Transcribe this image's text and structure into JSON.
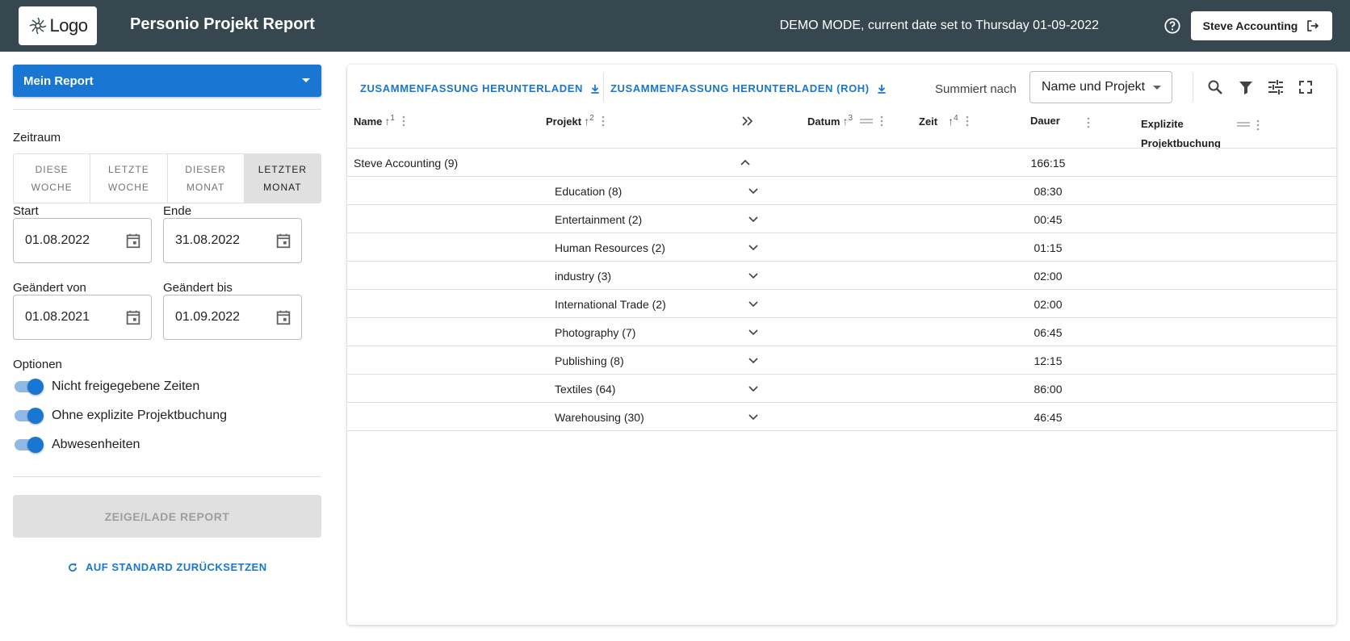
{
  "header": {
    "logo_text": "Logo",
    "title": "Personio Projekt Report",
    "demo_text": "DEMO MODE, current date set to Thursday 01-09-2022",
    "user_button": "Steve Accounting",
    "bg_color": "#37474f"
  },
  "sidebar": {
    "report_select": "Mein Report",
    "zeitraum_label": "Zeitraum",
    "zeitraum_options": [
      {
        "line1": "DIESE",
        "line2": "WOCHE"
      },
      {
        "line1": "LETZTE",
        "line2": "WOCHE"
      },
      {
        "line1": "DIESER",
        "line2": "MONAT"
      },
      {
        "line1": "LETZTER",
        "line2": "MONAT"
      }
    ],
    "zeitraum_selected": "LETZTER MONAT",
    "start_label": "Start",
    "start_value": "01.08.2022",
    "ende_label": "Ende",
    "ende_value": "31.08.2022",
    "geaendert_von_label": "Geändert von",
    "geaendert_von_value": "01.08.2021",
    "geaendert_bis_label": "Geändert bis",
    "geaendert_bis_value": "01.09.2022",
    "optionen_label": "Optionen",
    "options": [
      {
        "label": "Nicht freigegebene Zeiten",
        "on": true
      },
      {
        "label": "Ohne explizite Projektbuchung",
        "on": true
      },
      {
        "label": "Abwesenheiten",
        "on": true
      }
    ],
    "zeige_button": "ZEIGE/LADE REPORT",
    "reset_link": "AUF STANDARD ZURÜCKSETZEN",
    "accent_color": "#1976d2"
  },
  "toolbar": {
    "download_summary": "ZUSAMMENFASSUNG HERUNTERLADEN",
    "download_summary_raw": "ZUSAMMENFASSUNG HERUNTERLADEN (ROH)",
    "summiert_label": "Summiert nach",
    "summiert_value": "Name und Projekt",
    "icons": [
      "search-icon",
      "filter-icon",
      "tune-icon",
      "fullscreen-icon"
    ]
  },
  "table": {
    "columns": {
      "name": {
        "label": "Name",
        "sort": "1"
      },
      "projekt": {
        "label": "Projekt",
        "sort": "2"
      },
      "datum": {
        "label": "Datum",
        "sort": "3"
      },
      "zeit": {
        "label": "Zeit",
        "sort": "4"
      },
      "dauer": {
        "label": "Dauer"
      },
      "explizit": {
        "label_line1": "Explizite",
        "label_line2": "Projektbuchung"
      }
    },
    "group": {
      "name": "Steve Accounting (9)",
      "dauer": "166:15"
    },
    "rows": [
      {
        "projekt": "Education (8)",
        "dauer": "08:30"
      },
      {
        "projekt": "Entertainment (2)",
        "dauer": "00:45"
      },
      {
        "projekt": "Human Resources (2)",
        "dauer": "01:15"
      },
      {
        "projekt": "industry (3)",
        "dauer": "02:00"
      },
      {
        "projekt": "International Trade (2)",
        "dauer": "02:00"
      },
      {
        "projekt": "Photography (7)",
        "dauer": "06:45"
      },
      {
        "projekt": "Publishing (8)",
        "dauer": "12:15"
      },
      {
        "projekt": "Textiles (64)",
        "dauer": "86:00"
      },
      {
        "projekt": "Warehousing (30)",
        "dauer": "46:45"
      }
    ]
  }
}
